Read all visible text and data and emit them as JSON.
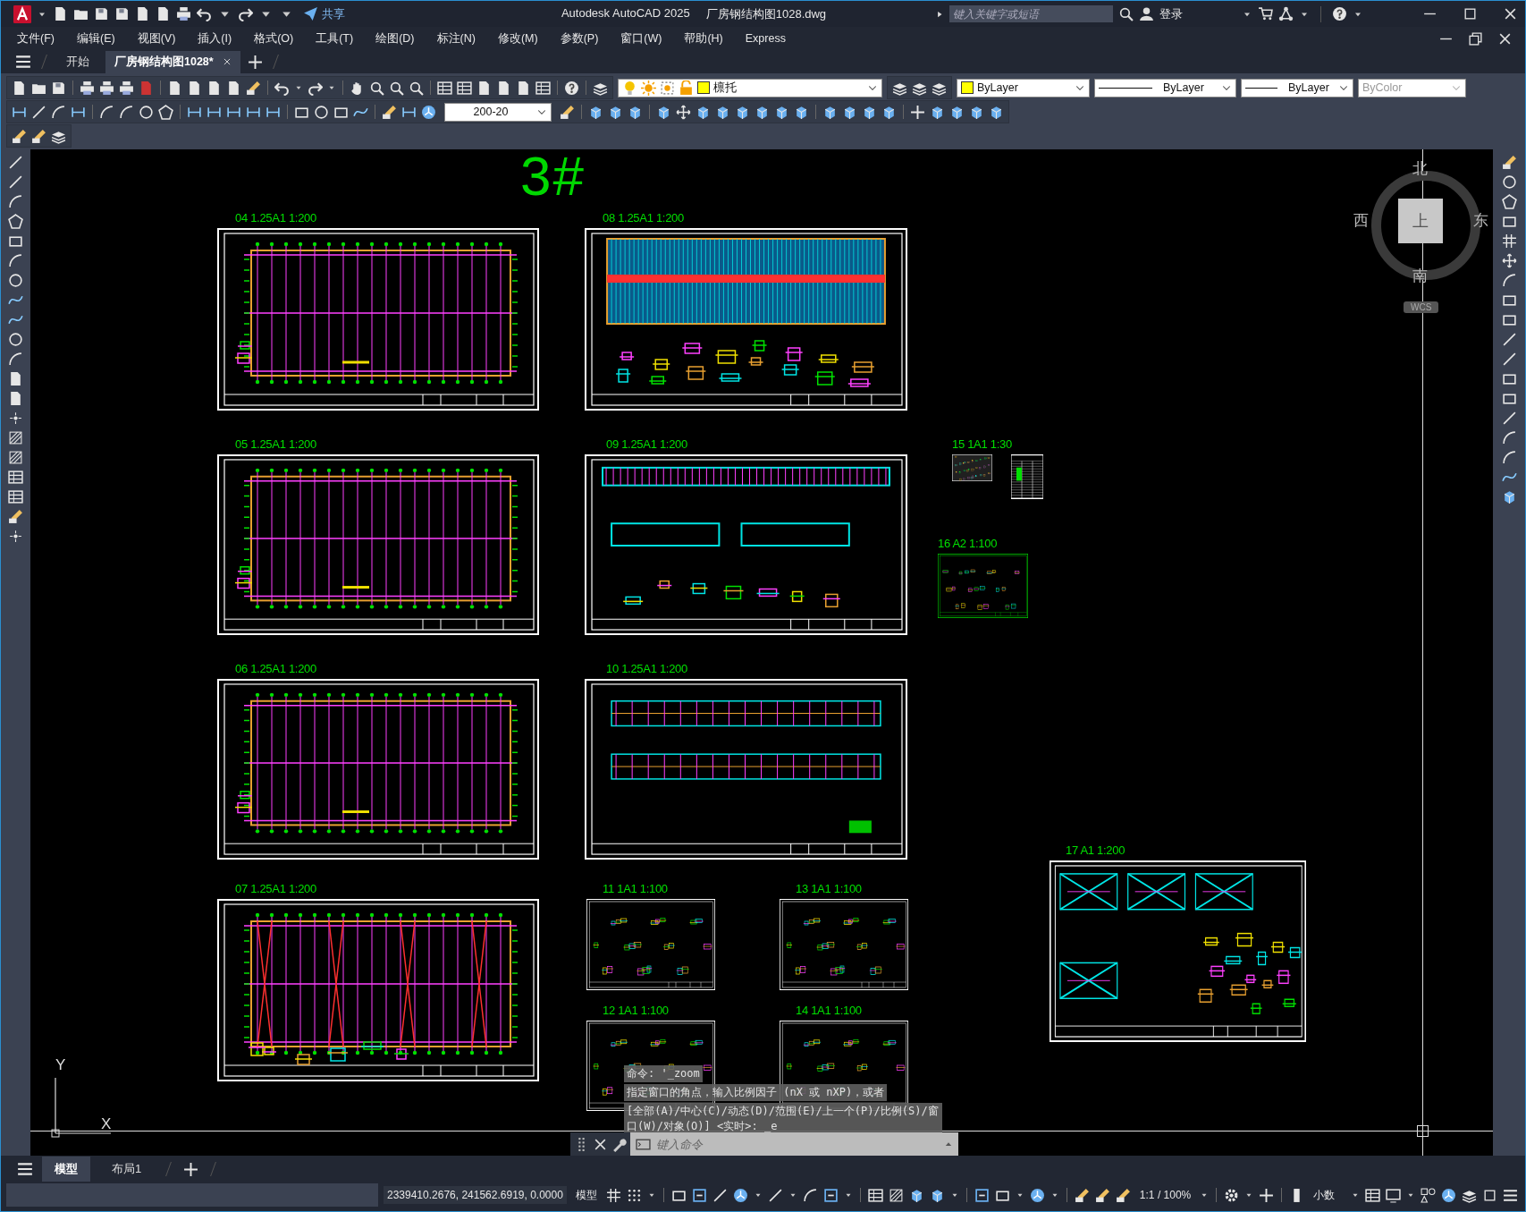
{
  "title_bar": {
    "share": "共享",
    "app_title": "Autodesk AutoCAD 2025",
    "file_name": "厂房钢结构图1028.dwg",
    "search": {
      "placeholder": "键入关键字或短语"
    },
    "sign_in": "登录"
  },
  "menu": [
    "文件(F)",
    "编辑(E)",
    "视图(V)",
    "插入(I)",
    "格式(O)",
    "工具(T)",
    "绘图(D)",
    "标注(N)",
    "修改(M)",
    "参数(P)",
    "窗口(W)",
    "帮助(H)",
    "Express"
  ],
  "file_tabs": [
    {
      "label": "开始",
      "selected": false
    },
    {
      "label": "厂房钢结构图1028*",
      "selected": true
    }
  ],
  "properties_toolbar": {
    "layer": "檩托",
    "color_value": "ByLayer",
    "linetype": "ByLayer",
    "lineweight": "ByLayer",
    "plot_style": {
      "value": "ByColor",
      "disabled": true
    }
  },
  "dimension_style": "200-20",
  "drawing": {
    "title": "3#",
    "sheets": [
      {
        "label": "04 1.25A1 1:200",
        "kind": "plan"
      },
      {
        "label": "08 1.25A1 1:200",
        "kind": "roof"
      },
      {
        "label": "05 1.25A1 1:200",
        "kind": "plan"
      },
      {
        "label": "09 1.25A1 1:200",
        "kind": "elevation"
      },
      {
        "label": "15 1A1 1:30",
        "kind": "thumbnail"
      },
      {
        "kind": "table"
      },
      {
        "label": "16 A2 1:100",
        "kind": "green-detail"
      },
      {
        "label": "06 1.25A1 1:200",
        "kind": "plan"
      },
      {
        "label": "10 1.25A1 1:200",
        "kind": "section"
      },
      {
        "label": "17 A1 1:200",
        "kind": "bracing-detail"
      },
      {
        "label": "07 1.25A1 1:200",
        "kind": "bracing"
      },
      {
        "label": "11 1A1 1:100",
        "kind": "detail"
      },
      {
        "label": "13 1A1 1:100",
        "kind": "detail"
      },
      {
        "label": "12 1A1 1:100",
        "kind": "detail"
      },
      {
        "label": "14 1A1 1:100",
        "kind": "detail"
      }
    ],
    "compass": {
      "north": "北",
      "south": "南",
      "west": "西",
      "east": "东",
      "face": "上",
      "ucs": "WCS"
    },
    "ucs_axes": {
      "y": "Y",
      "x": "X"
    }
  },
  "command_history": [
    "命令: '_zoom",
    "指定窗口的角点，输入比例因子 (nX 或 nXP)，或者",
    "[全部(A)/中心(C)/动态(D)/范围(E)/上一个(P)/比例(S)/窗口(W)/对象(O)] <实时>: _e"
  ],
  "command_input": {
    "placeholder": "键入命令"
  },
  "layout_tabs": [
    {
      "label": "模型",
      "selected": true
    },
    {
      "label": "布局1",
      "selected": false
    }
  ],
  "status_bar": {
    "coordinates": "2339410.2676, 241562.6919, 0.0000",
    "space": "模型",
    "annotation_scale": "1:1 / 100%",
    "units": "小数"
  }
}
